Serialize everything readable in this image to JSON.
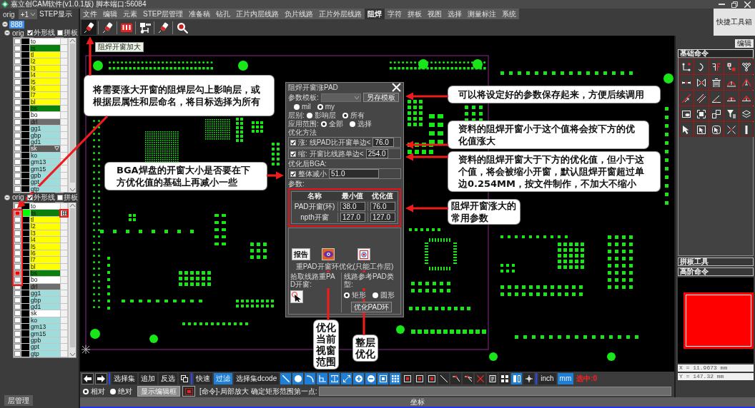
{
  "window": {
    "title": "嘉立创CAM软件(v1.0.1版) 脚本端口:56084"
  },
  "step_bar": {
    "step": "orig",
    "combo": "+1",
    "button": "STEP显示"
  },
  "tree": {
    "root": {
      "label": "888",
      "expanded": true,
      "selected": true
    },
    "groups": [
      {
        "label": "orig",
        "expanded": true,
        "outline": {
          "label": "外形线",
          "checked": true
        },
        "panel": {
          "label": "拼板",
          "checked": false
        },
        "layers": [
          {
            "name": "to",
            "color": "#ffffff",
            "checked": false,
            "selected": false,
            "work": false
          },
          {
            "name": "ts",
            "color": "#0c800c",
            "checked": false,
            "selected": false,
            "work": false
          },
          {
            "name": "tl",
            "color": "#ffff00",
            "checked": false,
            "selected": false,
            "work": false
          },
          {
            "name": "l2",
            "color": "#ffff00",
            "checked": false,
            "selected": false,
            "work": false
          },
          {
            "name": "l3",
            "color": "#ffff00",
            "checked": false,
            "selected": false,
            "work": false
          },
          {
            "name": "l4",
            "color": "#ffff00",
            "checked": false,
            "selected": false,
            "work": false
          },
          {
            "name": "l5",
            "color": "#ffff00",
            "checked": false,
            "selected": false,
            "work": false
          },
          {
            "name": "l6",
            "color": "#ffff00",
            "checked": false,
            "selected": false,
            "work": false
          },
          {
            "name": "l7",
            "color": "#ffff00",
            "checked": false,
            "selected": false,
            "work": false
          },
          {
            "name": "bl",
            "color": "#ffff00",
            "checked": false,
            "selected": false,
            "work": false
          },
          {
            "name": "bs",
            "color": "#0c800c",
            "checked": false,
            "selected": false,
            "work": false
          },
          {
            "name": "bo",
            "color": "#ffffff",
            "checked": false,
            "selected": false,
            "work": false
          },
          {
            "name": "drl",
            "color": "#6e6e6e",
            "checked": false,
            "selected": false,
            "work": false
          },
          {
            "name": "gg1",
            "color": "#9fdcdc",
            "checked": false,
            "selected": false,
            "work": false
          },
          {
            "name": "gbp",
            "color": "#9fdcdc",
            "checked": false,
            "selected": false,
            "work": false
          },
          {
            "name": "gd1",
            "color": "#9fdcdc",
            "checked": false,
            "selected": false,
            "work": false
          },
          {
            "name": "sk",
            "color": "#5c5c5c",
            "checked": false,
            "selected": true,
            "work": false
          },
          {
            "name": "ko",
            "color": "#9fdcdc",
            "checked": false,
            "selected": false,
            "work": false
          },
          {
            "name": "gm13",
            "color": "#9fdcdc",
            "checked": false,
            "selected": false,
            "work": false
          },
          {
            "name": "gm15",
            "color": "#9fdcdc",
            "checked": false,
            "selected": false,
            "work": false
          },
          {
            "name": "gpb",
            "color": "#9fdcdc",
            "checked": false,
            "selected": false,
            "work": false
          },
          {
            "name": "gpt",
            "color": "#9fdcdc",
            "checked": false,
            "selected": false,
            "work": false
          },
          {
            "name": "gtp",
            "color": "#9fdcdc",
            "checked": false,
            "selected": false,
            "work": false
          }
        ]
      },
      {
        "label": "orig",
        "expanded": true,
        "outline": {
          "label": "外形线",
          "checked": true
        },
        "panel": {
          "label": "拼板",
          "checked": false
        },
        "layers": [
          {
            "name": "to",
            "color": "#ffffff",
            "checked": false,
            "selected": false,
            "work": false
          },
          {
            "name": "ts",
            "color": "#0c800c",
            "checked": true,
            "selected": false,
            "work": true
          },
          {
            "name": "tl",
            "color": "#ffff00",
            "checked": false,
            "selected": false,
            "work": false
          },
          {
            "name": "l2",
            "color": "#ffff00",
            "checked": false,
            "selected": false,
            "work": false
          },
          {
            "name": "l3",
            "color": "#ffff00",
            "checked": false,
            "selected": false,
            "work": false
          },
          {
            "name": "l4",
            "color": "#ffff00",
            "checked": false,
            "selected": false,
            "work": false
          },
          {
            "name": "l5",
            "color": "#ffff00",
            "checked": false,
            "selected": false,
            "work": false
          },
          {
            "name": "l6",
            "color": "#ffff00",
            "checked": false,
            "selected": false,
            "work": false
          },
          {
            "name": "l7",
            "color": "#ffff00",
            "checked": false,
            "selected": false,
            "work": false
          },
          {
            "name": "bl",
            "color": "#ffff00",
            "checked": false,
            "selected": false,
            "work": false
          },
          {
            "name": "bs",
            "color": "#0c800c",
            "checked": true,
            "selected": false,
            "work": false
          },
          {
            "name": "bo",
            "color": "#ffffff",
            "checked": false,
            "selected": false,
            "work": false
          },
          {
            "name": "drl",
            "color": "#6e6e6e",
            "checked": false,
            "selected": false,
            "work": false
          },
          {
            "name": "gg1",
            "color": "#9fdcdc",
            "checked": false,
            "selected": false,
            "work": false
          },
          {
            "name": "gbp",
            "color": "#9fdcdc",
            "checked": false,
            "selected": false,
            "work": false
          },
          {
            "name": "gd1",
            "color": "#9fdcdc",
            "checked": false,
            "selected": false,
            "work": false
          },
          {
            "name": "sk",
            "color": "#ffffff",
            "checked": false,
            "selected": false,
            "work": false
          },
          {
            "name": "ko",
            "color": "#9fdcdc",
            "checked": false,
            "selected": false,
            "work": false
          },
          {
            "name": "gm13",
            "color": "#9fdcdc",
            "checked": false,
            "selected": false,
            "work": false
          },
          {
            "name": "gm15",
            "color": "#9fdcdc",
            "checked": false,
            "selected": false,
            "work": false
          },
          {
            "name": "gpb",
            "color": "#9fdcdc",
            "checked": false,
            "selected": false,
            "work": false
          },
          {
            "name": "gpt",
            "color": "#9fdcdc",
            "checked": false,
            "selected": false,
            "work": false
          },
          {
            "name": "gtp",
            "color": "#9fdcdc",
            "checked": false,
            "selected": false,
            "work": false
          }
        ]
      }
    ]
  },
  "layer_tab": "层管理",
  "menu": [
    {
      "label": "文件",
      "selected": false
    },
    {
      "label": "编辑",
      "selected": false
    },
    {
      "label": "元素",
      "selected": false
    },
    {
      "label": "STEP层管理",
      "selected": false
    },
    {
      "label": "准备稿",
      "selected": false
    },
    {
      "label": "钻孔",
      "selected": false
    },
    {
      "label": "正片内层线路",
      "selected": false
    },
    {
      "label": "负片线路",
      "selected": false
    },
    {
      "label": "正片外层线路",
      "selected": false
    },
    {
      "label": "阻焊",
      "selected": true
    },
    {
      "label": "字符",
      "selected": false
    },
    {
      "label": "拼板",
      "selected": false
    },
    {
      "label": "视图",
      "selected": false
    },
    {
      "label": "选择",
      "selected": false
    },
    {
      "label": "测量标注",
      "selected": false
    },
    {
      "label": "系统",
      "selected": false
    }
  ],
  "toolbar": {
    "buttons": [
      {
        "kind": "pen",
        "selected": true
      },
      {
        "kind": "pen",
        "selected": false
      },
      {
        "kind": "bars",
        "selected": false
      },
      {
        "kind": "circuit",
        "selected": false
      },
      {
        "kind": "pen",
        "selected": false
      },
      {
        "kind": "search",
        "selected": false
      }
    ],
    "tooltip": "阻焊开窗加大"
  },
  "quick_toolbox": "快捷工具箱",
  "dialog": {
    "title": "阻焊开窗涨PAD",
    "template": {
      "label": "参数模板:",
      "button": "另存模板"
    },
    "units": [
      {
        "label": "mil",
        "selected": false
      },
      {
        "label": "my",
        "selected": true
      }
    ],
    "layer_scope": {
      "label": "层别:",
      "options": [
        {
          "label": "影响层",
          "selected": false
        },
        {
          "label": "所有",
          "selected": true
        }
      ]
    },
    "apply_scope": {
      "label": "应用范围:",
      "options": [
        {
          "label": "全部",
          "selected": true
        },
        {
          "label": "选择",
          "selected": false
        }
      ]
    },
    "method_label": "优化方法",
    "methods": [
      {
        "checked": true,
        "label": "涨:",
        "text": "线PAD比开窗单边<",
        "value": "76.0"
      },
      {
        "checked": true,
        "label": "缩:",
        "text": "开窗比线路单边<",
        "value": "254.0"
      }
    ],
    "bga_label": "优化后BGA:",
    "bga": {
      "checked": true,
      "label": "整体减小",
      "value": "51.0"
    },
    "params_label": "参数:",
    "params": {
      "columns": [
        "名称",
        "最小值",
        "优化值"
      ],
      "rows": [
        {
          "name": "PAD开窗(环)",
          "min": "38.0",
          "opt": "76.0"
        },
        {
          "name": "npth开窗",
          "min": "127.0",
          "opt": "127.0"
        }
      ]
    },
    "report_button": "报告",
    "action_buttons": [
      {
        "kind": "eye"
      },
      {
        "kind": "frame"
      }
    ],
    "ring_note": "重PAD开窗环优化(只能工作层)",
    "pick_label": "拾取线路重PAD开窗:",
    "pad_type": {
      "label": "线路参考PAD类型:",
      "options": [
        {
          "label": "矩形",
          "selected": true
        },
        {
          "label": "圆形",
          "selected": false
        }
      ]
    },
    "optimize_button": "优化PAD环"
  },
  "callouts": [
    {
      "kind": "box",
      "text": "将需要涨大开窗的阻焊层勾上影响层，或根据层属性和层命名，将目标选择为所有"
    },
    {
      "kind": "box",
      "text": "BGA焊盘的开窗大小是否要在下方优化值的基础上再减小一些"
    },
    {
      "kind": "box",
      "text": "可以将设定好的参数保存起来，方便后续调用"
    },
    {
      "kind": "box",
      "text": "资料的阻焊开窗小于这个值将会按下方的优化值涨大"
    },
    {
      "kind": "box",
      "text": "资料的阻焊开窗大于下方的优化值，但小于这个值，将会被缩小开窗，默认阻焊开窗超过单边0.254MM，按文件制作，不加大不缩小"
    },
    {
      "kind": "box",
      "text": "阻焊开窗涨大的常用参数"
    },
    {
      "kind": "vertical",
      "text": "优化当前视窗范围"
    },
    {
      "kind": "vertical",
      "text": "整层优化"
    }
  ],
  "bottom_toolbar": {
    "select_buttons": [
      {
        "label": "选择集",
        "on": false
      },
      {
        "label": "追加",
        "on": false
      },
      {
        "label": "反选",
        "on": false
      }
    ],
    "modes": [
      {
        "label": "快速",
        "on": false
      },
      {
        "label": "过滤",
        "on": true
      },
      {
        "label": "选择集dcode",
        "on": false
      }
    ],
    "tools": [
      {
        "kind": "line",
        "on": true
      },
      {
        "kind": "circle",
        "on": true
      },
      {
        "kind": "arc",
        "on": true
      },
      {
        "kind": "corner",
        "on": true
      },
      {
        "kind": "bracket",
        "on": true
      },
      {
        "kind": "diagonal",
        "on": true
      },
      {
        "kind": "plus",
        "on": true
      },
      {
        "kind": "minus",
        "on": true
      },
      {
        "kind": "square",
        "on": true
      },
      {
        "kind": "dots",
        "on": true
      },
      {
        "kind": "boxdot",
        "on": false
      },
      {
        "kind": "boxdot",
        "on": false
      },
      {
        "kind": "boxdot",
        "on": false
      },
      {
        "kind": "slash",
        "on": false
      },
      {
        "kind": "nodeline",
        "on": false
      },
      {
        "kind": "nodebranch",
        "on": false
      },
      {
        "kind": "cross",
        "on": false
      },
      {
        "kind": "doc",
        "on": false
      },
      {
        "kind": "quad",
        "on": false
      },
      {
        "kind": "columns",
        "on": true
      },
      {
        "kind": "crosshair",
        "on": false
      }
    ],
    "units": [
      {
        "label": "inch",
        "selected": false
      },
      {
        "label": "mm",
        "selected": true
      }
    ],
    "count": "选中:0"
  },
  "command_bar": {
    "coord_modes": [
      {
        "label": "相对",
        "selected": true
      },
      {
        "label": "绝对",
        "selected": false
      }
    ],
    "editor_button": "显示编辑框",
    "prompt": "[命令]-局部放大 确定矩形范围第一点:"
  },
  "status_bar": "坐标",
  "right_panel": {
    "edit_button": "编辑",
    "sections": [
      {
        "title": "基础命令",
        "expanded": true
      },
      {
        "title": "拼板工具",
        "expanded": false
      },
      {
        "title": "高阶命令",
        "expanded": false
      }
    ],
    "coords": [
      "X = 11.9673 mm",
      "Y = 147.32 mm"
    ]
  }
}
